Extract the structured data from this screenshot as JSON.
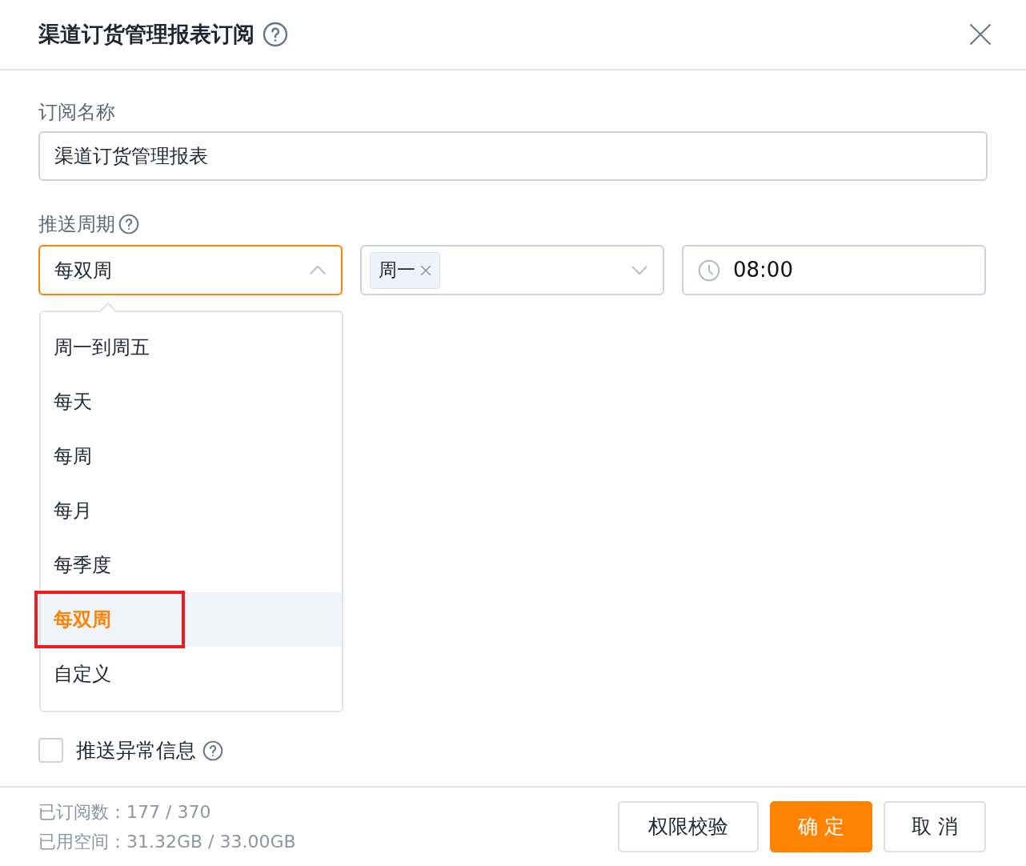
{
  "dialog": {
    "title": "渠道订货管理报表订阅"
  },
  "name_field": {
    "label": "订阅名称",
    "value": "渠道订货管理报表"
  },
  "push_cycle": {
    "label": "推送周期",
    "period": {
      "value": "每双周",
      "expanded": true
    },
    "weekday_tags": [
      {
        "label": "周一"
      }
    ],
    "time": {
      "value": "08:00"
    }
  },
  "period_options": [
    {
      "label": "周一到周五",
      "selected": false,
      "annotated": false
    },
    {
      "label": "每天",
      "selected": false,
      "annotated": false
    },
    {
      "label": "每周",
      "selected": false,
      "annotated": false
    },
    {
      "label": "每月",
      "selected": false,
      "annotated": false
    },
    {
      "label": "每季度",
      "selected": false,
      "annotated": false
    },
    {
      "label": "每双周",
      "selected": true,
      "annotated": true
    },
    {
      "label": "自定义",
      "selected": false,
      "annotated": false
    }
  ],
  "exception": {
    "label": "推送异常信息",
    "checked": false
  },
  "footer": {
    "stats": [
      "已订阅数：177 / 370",
      "已用空间：31.32GB / 33.00GB"
    ],
    "buttons": [
      {
        "label": "权限校验",
        "kind": "secondary"
      },
      {
        "label": "确 定",
        "kind": "primary"
      },
      {
        "label": "取 消",
        "kind": "secondary"
      }
    ]
  }
}
